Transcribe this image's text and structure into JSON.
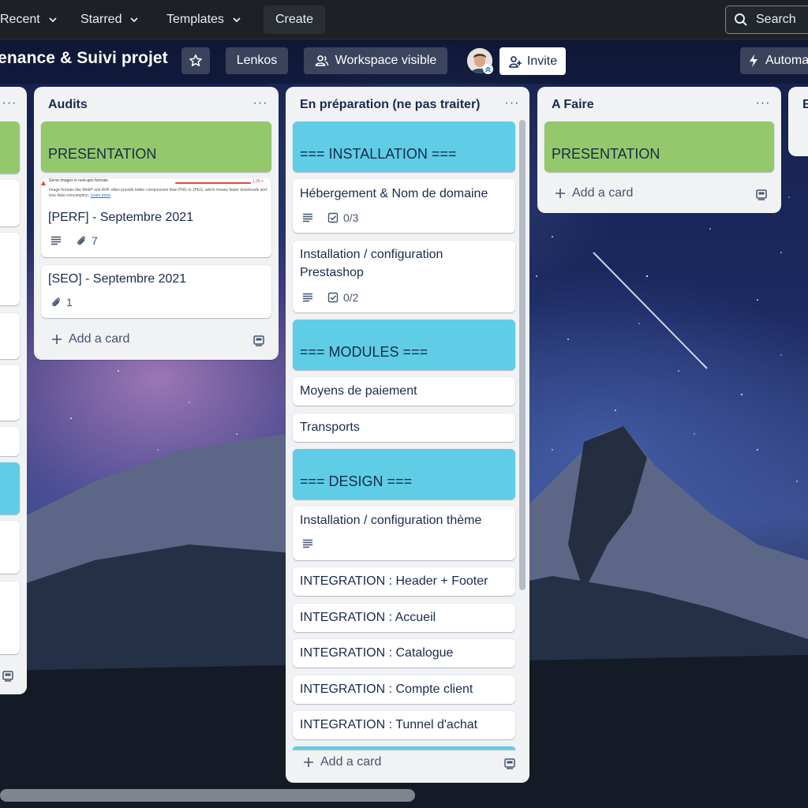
{
  "nav": {
    "recent": "Recent",
    "starred": "Starred",
    "templates": "Templates",
    "create": "Create",
    "search": "Search"
  },
  "board": {
    "title": "tenance & Suivi projet",
    "workspace": "Lenkos",
    "visibility": "Workspace visible",
    "invite": "Invite",
    "automation": "Automa"
  },
  "lists": {
    "audits": {
      "title": "Audits",
      "cover_card": "PRESENTATION",
      "perf_preview": {
        "heading": "Serve images in next-gen formats",
        "value": "1.95 s",
        "text": "Image formats like WebP and AVIF often provide better compression than PNG or JPEG, which means faster downloads and less data consumption.",
        "link": "Learn more"
      },
      "cards": [
        {
          "title": "[PERF] - Septembre 2021",
          "attachments": "7"
        },
        {
          "title": "[SEO] - Septembre 2021",
          "attachments": "1"
        }
      ],
      "add": "Add a card"
    },
    "preparation": {
      "title": "En préparation (ne pas traiter)",
      "sections": {
        "installation": "=== INSTALLATION ===",
        "modules": "=== MODULES ===",
        "design": "=== DESIGN ==="
      },
      "cards": [
        {
          "title": "Hébergement & Nom de domaine",
          "checklist": "0/3"
        },
        {
          "title_line1": "Installation / configuration",
          "title_line2": "Prestashop",
          "checklist": "0/2"
        },
        {
          "title": "Moyens de paiement"
        },
        {
          "title": "Transports"
        },
        {
          "title": "Installation / configuration thème"
        },
        {
          "title": "INTEGRATION : Header + Footer"
        },
        {
          "title": "INTEGRATION : Accueil"
        },
        {
          "title": "INTEGRATION : Catalogue"
        },
        {
          "title": "INTEGRATION : Compte client"
        },
        {
          "title": "INTEGRATION : Tunnel d'achat"
        }
      ],
      "add": "Add a card"
    },
    "afaire": {
      "title": "A Faire",
      "cover_card": "PRESENTATION",
      "add": "Add a card"
    },
    "next": {
      "title": "E"
    }
  },
  "icons": {
    "search": "search-icon",
    "star": "star-icon",
    "people": "people-icon",
    "add_user": "add-user-icon",
    "lightning": "lightning-icon",
    "description": "description-icon",
    "checklist": "checklist-icon",
    "attachment": "paperclip-icon",
    "template": "card-template-icon"
  }
}
